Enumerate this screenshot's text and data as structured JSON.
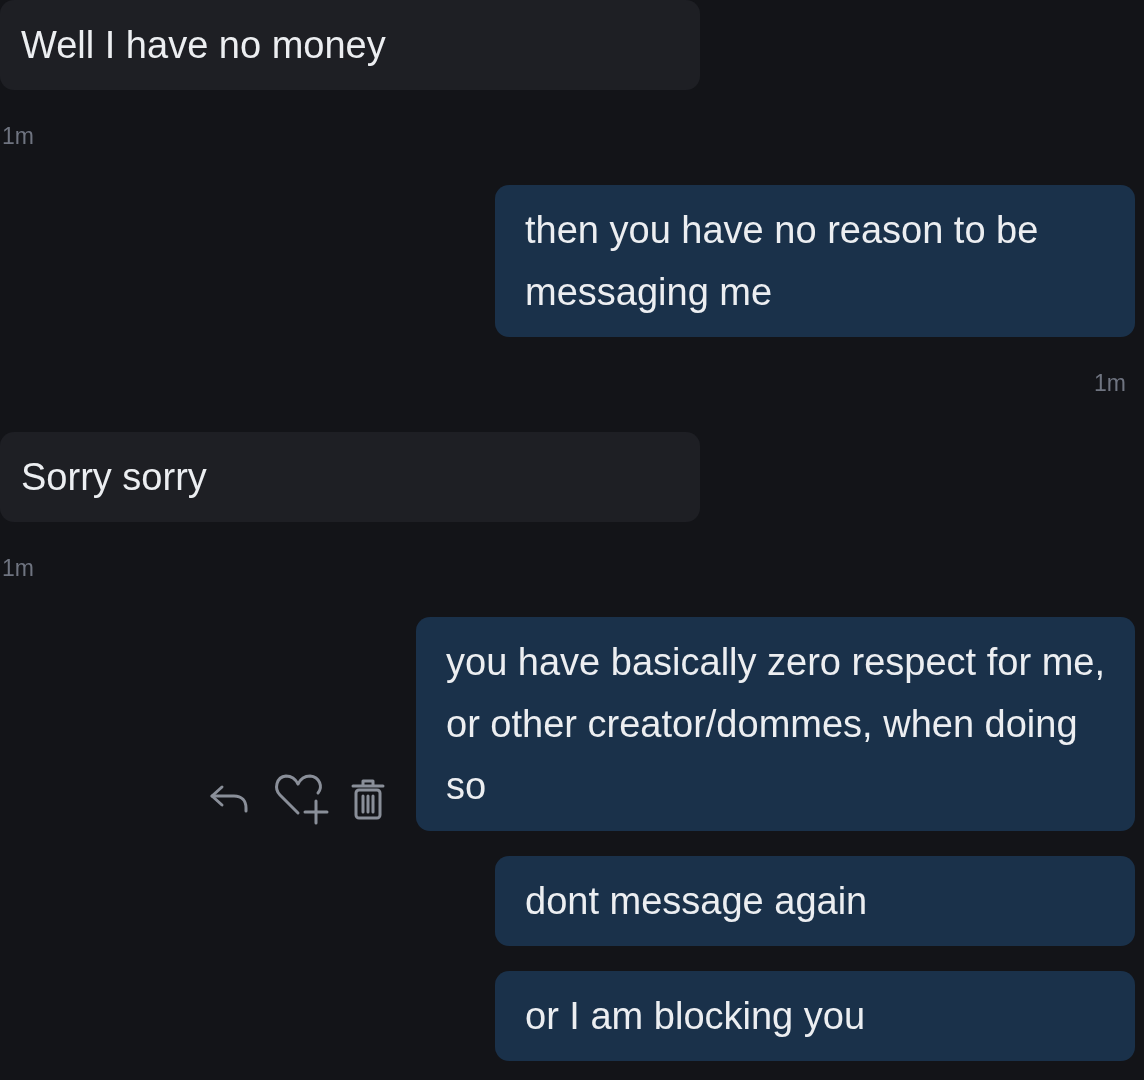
{
  "messages": [
    {
      "kind": "incoming",
      "text": "Well I have no money",
      "time": "1m"
    },
    {
      "kind": "outgoing",
      "text": "then you have no reason to be\nmessaging me",
      "time": "1m"
    },
    {
      "kind": "incoming",
      "text": "Sorry sorry",
      "time": "1m"
    },
    {
      "kind": "outgoing",
      "text": "you have basically zero respect for me,\nor other creator/dommes, when doing\nso",
      "actions": true
    },
    {
      "kind": "outgoing",
      "text": "dont message again"
    },
    {
      "kind": "outgoing",
      "text": "or I am blocking you"
    }
  ]
}
